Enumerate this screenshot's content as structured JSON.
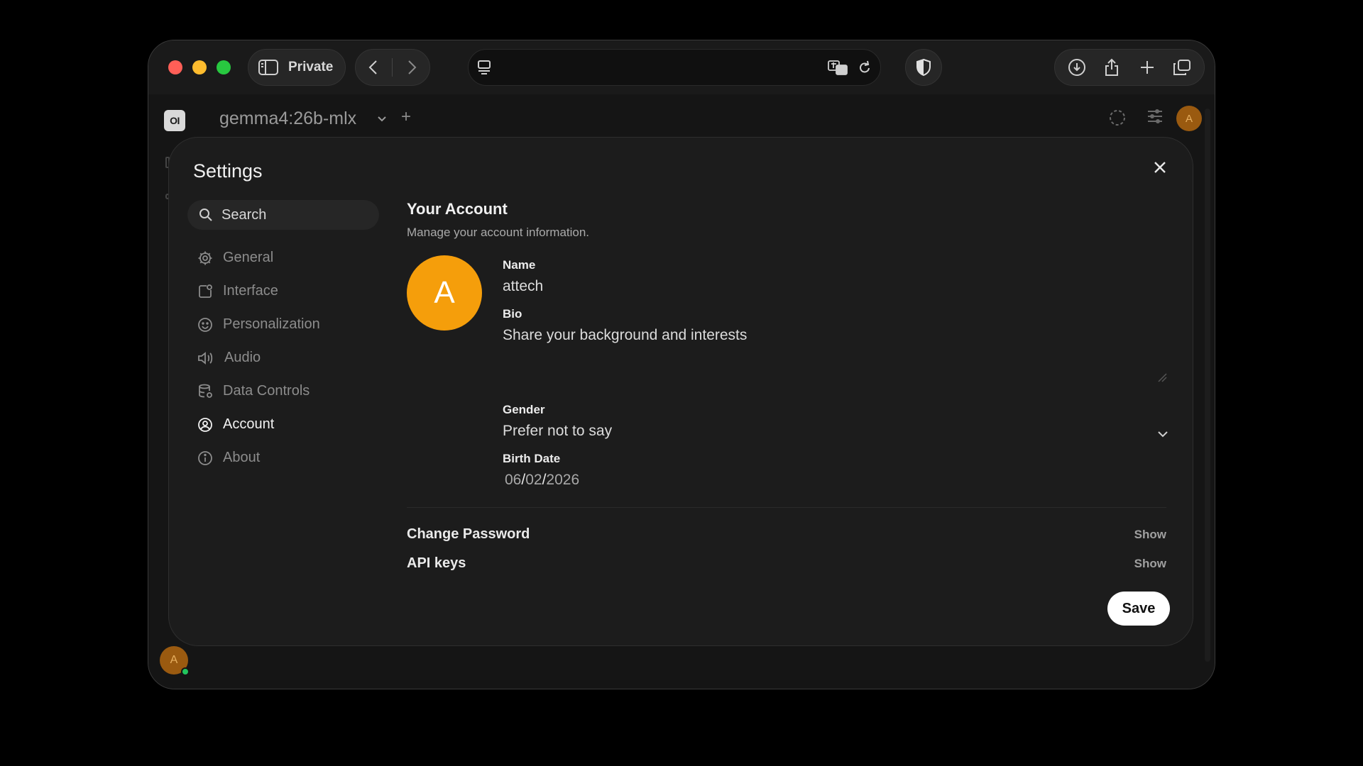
{
  "browser": {
    "private_label": "Private"
  },
  "app": {
    "logo_text": "OI",
    "model_name": "gemma4:26b-mlx",
    "add_symbol": "+",
    "user_initial": "A"
  },
  "settings": {
    "title": "Settings",
    "search_placeholder": "Search",
    "nav": [
      {
        "label": "General",
        "icon": "gear-icon"
      },
      {
        "label": "Interface",
        "icon": "interface-icon"
      },
      {
        "label": "Personalization",
        "icon": "smile-icon"
      },
      {
        "label": "Audio",
        "icon": "speaker-icon"
      },
      {
        "label": "Data Controls",
        "icon": "database-icon"
      },
      {
        "label": "Account",
        "icon": "user-circle-icon"
      },
      {
        "label": "About",
        "icon": "info-icon"
      }
    ],
    "active_nav": "Account"
  },
  "account": {
    "section_title": "Your Account",
    "section_subtitle": "Manage your account information.",
    "avatar_initial": "A",
    "name_label": "Name",
    "name_value": "attech",
    "bio_label": "Bio",
    "bio_placeholder": "Share your background and interests",
    "gender_label": "Gender",
    "gender_value": "Prefer not to say",
    "birth_label": "Birth Date",
    "birth_month": "06",
    "birth_day": "02",
    "birth_year": "2026",
    "date_sep": "/",
    "change_password_label": "Change Password",
    "change_password_action": "Show",
    "api_keys_label": "API keys",
    "api_keys_action": "Show",
    "save_label": "Save"
  },
  "colors": {
    "avatar": "#f59e0b",
    "status_online": "#22c55e",
    "traffic_red": "#ff5f57",
    "traffic_yellow": "#febc2e",
    "traffic_green": "#28c840"
  }
}
